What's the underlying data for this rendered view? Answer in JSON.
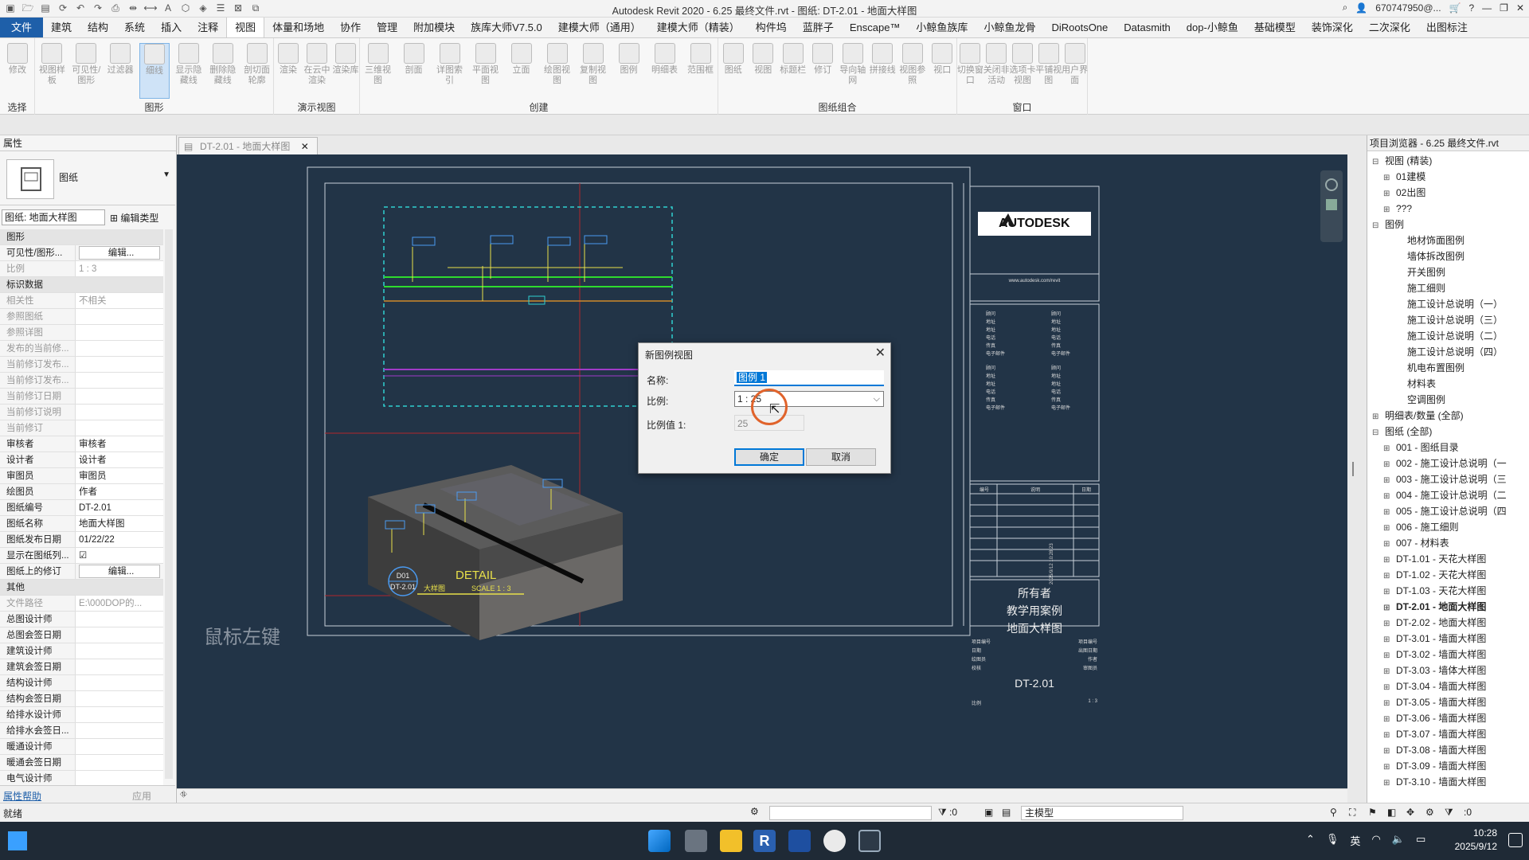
{
  "window": {
    "title": "Autodesk Revit 2020 - 6.25 最终文件.rvt - 图纸: DT-2.01 - 地面大样图",
    "user": "670747950@...",
    "quick_access_icons": [
      "app-menu-icon",
      "open-icon",
      "save-icon",
      "sync-icon",
      "undo-icon",
      "redo-icon",
      "print-icon",
      "measure-icon",
      "dimension-icon",
      "text-icon",
      "3d-view-icon",
      "section-icon",
      "thin-lines-icon",
      "close-hidden-icon",
      "switch-windows-icon"
    ]
  },
  "menu_tabs": [
    "文件",
    "建筑",
    "结构",
    "系统",
    "插入",
    "注释",
    "视图",
    "体量和场地",
    "协作",
    "管理",
    "附加模块",
    "族库大师V7.5.0",
    "建模大师（通用）",
    "建模大师（精装）",
    "构件坞",
    "蓝胖子",
    "Enscape™",
    "小鲸鱼族库",
    "小鲸鱼龙骨",
    "DiRootsOne",
    "Datasmith",
    "dop-小鲸鱼",
    "基础模型",
    "装饰深化",
    "二次深化",
    "出图标注"
  ],
  "active_tab": "视图",
  "ribbon": {
    "groups": [
      {
        "label": "选择",
        "buttons": [
          "修改"
        ]
      },
      {
        "label": "图形",
        "buttons": [
          "视图样板",
          "可见性/图形",
          "过滤器",
          "细线",
          "显示隐藏线",
          "删除隐藏线",
          "剖切面轮廓"
        ]
      },
      {
        "label": "演示视图",
        "buttons": [
          "渲染",
          "在云中渲染",
          "渲染库"
        ]
      },
      {
        "label": "创建",
        "buttons": [
          "三维视图",
          "剖面",
          "详图索引",
          "平面视图",
          "立面",
          "绘图视图",
          "复制视图",
          "图例",
          "明细表",
          "范围框"
        ]
      },
      {
        "label": "图纸组合",
        "buttons": [
          "图纸",
          "视图",
          "标题栏",
          "修订",
          "导向轴网",
          "拼接线",
          "视图参照",
          "视口"
        ]
      },
      {
        "label": "窗口",
        "buttons": [
          "切换窗口",
          "关闭非活动",
          "选项卡视图",
          "平铺视图",
          "用户界面"
        ]
      }
    ]
  },
  "properties": {
    "title": "属性",
    "type_name": "图纸",
    "selector": "图纸: 地面大样图",
    "edit_type": "编辑类型",
    "rows": [
      {
        "section": true,
        "k": "图形"
      },
      {
        "k": "可见性/图形...",
        "v": "编辑...",
        "btn": true
      },
      {
        "k": "比例",
        "v": "1 : 3",
        "dim": true
      },
      {
        "section": true,
        "k": "标识数据"
      },
      {
        "k": "相关性",
        "v": "不相关",
        "dim": true
      },
      {
        "k": "参照图纸",
        "v": "",
        "dim": true
      },
      {
        "k": "参照详图",
        "v": "",
        "dim": true
      },
      {
        "k": "发布的当前修...",
        "v": "",
        "dim": true
      },
      {
        "k": "当前修订发布...",
        "v": "",
        "dim": true
      },
      {
        "k": "当前修订发布...",
        "v": "",
        "dim": true
      },
      {
        "k": "当前修订日期",
        "v": "",
        "dim": true
      },
      {
        "k": "当前修订说明",
        "v": "",
        "dim": true
      },
      {
        "k": "当前修订",
        "v": "",
        "dim": true
      },
      {
        "k": "审核者",
        "v": "审核者"
      },
      {
        "k": "设计者",
        "v": "设计者"
      },
      {
        "k": "审图员",
        "v": "审图员"
      },
      {
        "k": "绘图员",
        "v": "作者"
      },
      {
        "k": "图纸编号",
        "v": "DT-2.01"
      },
      {
        "k": "图纸名称",
        "v": "地面大样图"
      },
      {
        "k": "图纸发布日期",
        "v": "01/22/22"
      },
      {
        "k": "显示在图纸列...",
        "v": "☑"
      },
      {
        "k": "图纸上的修订",
        "v": "编辑...",
        "btn": true
      },
      {
        "section": true,
        "k": "其他"
      },
      {
        "k": "文件路径",
        "v": "E:\\000DOP的...",
        "dim": true
      },
      {
        "k": "总图设计师",
        "v": ""
      },
      {
        "k": "总图会签日期",
        "v": ""
      },
      {
        "k": "建筑设计师",
        "v": ""
      },
      {
        "k": "建筑会签日期",
        "v": ""
      },
      {
        "k": "结构设计师",
        "v": ""
      },
      {
        "k": "结构会签日期",
        "v": ""
      },
      {
        "k": "给排水设计师",
        "v": ""
      },
      {
        "k": "给排水会签日...",
        "v": ""
      },
      {
        "k": "暖通设计师",
        "v": ""
      },
      {
        "k": "暖通会签日期",
        "v": ""
      },
      {
        "k": "电气设计师",
        "v": ""
      }
    ],
    "help_link": "属性帮助",
    "apply": "应用"
  },
  "view_tab": {
    "label": "DT-2.01 - 地面大样图"
  },
  "canvas": {
    "hint": "鼠标左键",
    "titleblock": {
      "brand": "AUTODESK",
      "url": "www.autodesk.com/revit",
      "contacts_left": [
        "顾问",
        "地址",
        "地址",
        "电话",
        "传真",
        "电子邮件",
        "顾问",
        "地址",
        "地址",
        "电话",
        "传真",
        "电子邮件"
      ],
      "contacts_right": [
        "顾问",
        "地址",
        "地址",
        "电话",
        "传真",
        "电子邮件",
        "顾问",
        "地址",
        "地址",
        "电话",
        "传真",
        "电子邮件"
      ],
      "rev_headers": [
        "编号",
        "说明",
        "日期"
      ],
      "owner": "所有者",
      "project": "教学用案例",
      "sheet_name": "地面大样图",
      "fields": [
        {
          "k": "项目编号",
          "v": "项目编号"
        },
        {
          "k": "日期",
          "v": "出图日期"
        },
        {
          "k": "绘图员",
          "v": "作者"
        },
        {
          "k": "校核",
          "v": "审图员"
        }
      ],
      "sheet_no": "DT-2.01",
      "scale_label": "比例",
      "scale_value": "1 : 3",
      "side_date": "2025/9/12 10:28:23"
    },
    "detail_tag": {
      "number": "D01",
      "sheet": "DT-2.01",
      "title": "DETAIL",
      "subtitle": "大样图",
      "scale": "SCALE 1 : 3"
    }
  },
  "dialog": {
    "title": "新图例视图",
    "name_label": "名称:",
    "name_value": "图例 1",
    "scale_label": "比例:",
    "scale_value": "1 : 25",
    "scale_value_label": "比例值 1:",
    "scale_value_num": "25",
    "ok": "确定",
    "cancel": "取消"
  },
  "browser": {
    "title": "项目浏览器 - 6.25 最终文件.rvt",
    "items": [
      {
        "t": "视图 (精装)",
        "lvl": 0,
        "tg": "⊟"
      },
      {
        "t": "01建模",
        "lvl": 1,
        "tg": "⊞"
      },
      {
        "t": "02出图",
        "lvl": 1,
        "tg": "⊞"
      },
      {
        "t": "???",
        "lvl": 1,
        "tg": "⊞"
      },
      {
        "t": "图例",
        "lvl": 0,
        "tg": "⊟"
      },
      {
        "t": "地材饰面图例",
        "lvl": 2,
        "tg": ""
      },
      {
        "t": "墙体拆改图例",
        "lvl": 2,
        "tg": ""
      },
      {
        "t": "开关图例",
        "lvl": 2,
        "tg": ""
      },
      {
        "t": "施工细则",
        "lvl": 2,
        "tg": ""
      },
      {
        "t": "施工设计总说明（一）",
        "lvl": 2,
        "tg": ""
      },
      {
        "t": "施工设计总说明（三）",
        "lvl": 2,
        "tg": ""
      },
      {
        "t": "施工设计总说明（二）",
        "lvl": 2,
        "tg": ""
      },
      {
        "t": "施工设计总说明（四）",
        "lvl": 2,
        "tg": ""
      },
      {
        "t": "机电布置图例",
        "lvl": 2,
        "tg": ""
      },
      {
        "t": "材料表",
        "lvl": 2,
        "tg": ""
      },
      {
        "t": "空调图例",
        "lvl": 2,
        "tg": ""
      },
      {
        "t": "明细表/数量 (全部)",
        "lvl": 0,
        "tg": "⊞"
      },
      {
        "t": "图纸 (全部)",
        "lvl": 0,
        "tg": "⊟"
      },
      {
        "t": "001 - 图纸目录",
        "lvl": 1,
        "tg": "⊞"
      },
      {
        "t": "002 - 施工设计总说明（一",
        "lvl": 1,
        "tg": "⊞"
      },
      {
        "t": "003 - 施工设计总说明（三",
        "lvl": 1,
        "tg": "⊞"
      },
      {
        "t": "004 - 施工设计总说明（二",
        "lvl": 1,
        "tg": "⊞"
      },
      {
        "t": "005 - 施工设计总说明（四",
        "lvl": 1,
        "tg": "⊞"
      },
      {
        "t": "006 - 施工细则",
        "lvl": 1,
        "tg": "⊞"
      },
      {
        "t": "007 - 材料表",
        "lvl": 1,
        "tg": "⊞"
      },
      {
        "t": "DT-1.01 - 天花大样图",
        "lvl": 1,
        "tg": "⊞"
      },
      {
        "t": "DT-1.02 - 天花大样图",
        "lvl": 1,
        "tg": "⊞"
      },
      {
        "t": "DT-1.03 - 天花大样图",
        "lvl": 1,
        "tg": "⊞"
      },
      {
        "t": "DT-2.01 - 地面大样图",
        "lvl": 1,
        "tg": "⊞",
        "bold": true
      },
      {
        "t": "DT-2.02 - 地面大样图",
        "lvl": 1,
        "tg": "⊞"
      },
      {
        "t": "DT-3.01 - 墙面大样图",
        "lvl": 1,
        "tg": "⊞"
      },
      {
        "t": "DT-3.02 - 墙面大样图",
        "lvl": 1,
        "tg": "⊞"
      },
      {
        "t": "DT-3.03 - 墙体大样图",
        "lvl": 1,
        "tg": "⊞"
      },
      {
        "t": "DT-3.04 - 墙面大样图",
        "lvl": 1,
        "tg": "⊞"
      },
      {
        "t": "DT-3.05 - 墙面大样图",
        "lvl": 1,
        "tg": "⊞"
      },
      {
        "t": "DT-3.06 - 墙面大样图",
        "lvl": 1,
        "tg": "⊞"
      },
      {
        "t": "DT-3.07 - 墙面大样图",
        "lvl": 1,
        "tg": "⊞"
      },
      {
        "t": "DT-3.08 - 墙面大样图",
        "lvl": 1,
        "tg": "⊞"
      },
      {
        "t": "DT-3.09 - 墙面大样图",
        "lvl": 1,
        "tg": "⊞"
      },
      {
        "t": "DT-3.10 - 墙面大样图",
        "lvl": 1,
        "tg": "⊞"
      }
    ]
  },
  "status": {
    "left": "就绪",
    "zero": ":0",
    "model": "主模型",
    "zero2": ":0"
  },
  "taskbar": {
    "time": "10:28",
    "date": "2025/9/12",
    "ime": "英"
  }
}
